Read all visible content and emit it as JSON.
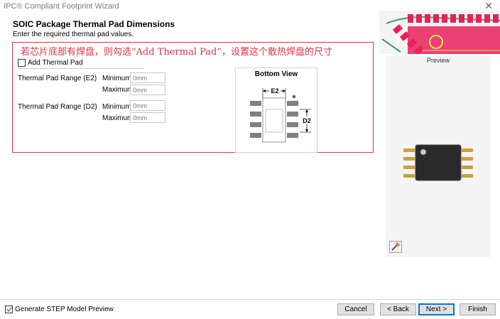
{
  "window": {
    "title": "IPC® Compliant Footprint Wizard",
    "close_glyph": "✕"
  },
  "header": {
    "title": "SOIC Package Thermal Pad Dimensions",
    "subtitle": "Enter the required thermal pad values."
  },
  "annotation": {
    "text": "若芯片底部有焊盘，则勾选“Add Thermal Pad”，设置这个散热焊盘的尺寸",
    "color": "#e03040"
  },
  "form": {
    "add_thermal_pad": {
      "label": "Add Thermal Pad",
      "checked": false
    },
    "e2": {
      "label": "Thermal Pad Range (E2)",
      "min_label": "Minimum",
      "min_placeholder": "0mm",
      "max_label": "Maximum",
      "max_placeholder": "0mm"
    },
    "d2": {
      "label": "Thermal Pad Range (D2)",
      "min_label": "Minimum",
      "min_placeholder": "0mm",
      "max_label": "Maximum",
      "max_placeholder": "0mm"
    }
  },
  "bottom_view": {
    "title": "Bottom View",
    "e2_label": "E2",
    "d2_label": "D2"
  },
  "preview": {
    "label": "Preview"
  },
  "footer": {
    "step_preview": {
      "label": "Generate STEP Model Preview",
      "checked": true
    },
    "cancel_label": "Cancel",
    "back_label": "< Back",
    "next_label": "Next >",
    "finish_label": "Finish"
  },
  "colors": {
    "accent": "#0078d7",
    "pcb_pad": "#e8205a",
    "body": "#2a2a2a",
    "lead": "#c8a040"
  }
}
